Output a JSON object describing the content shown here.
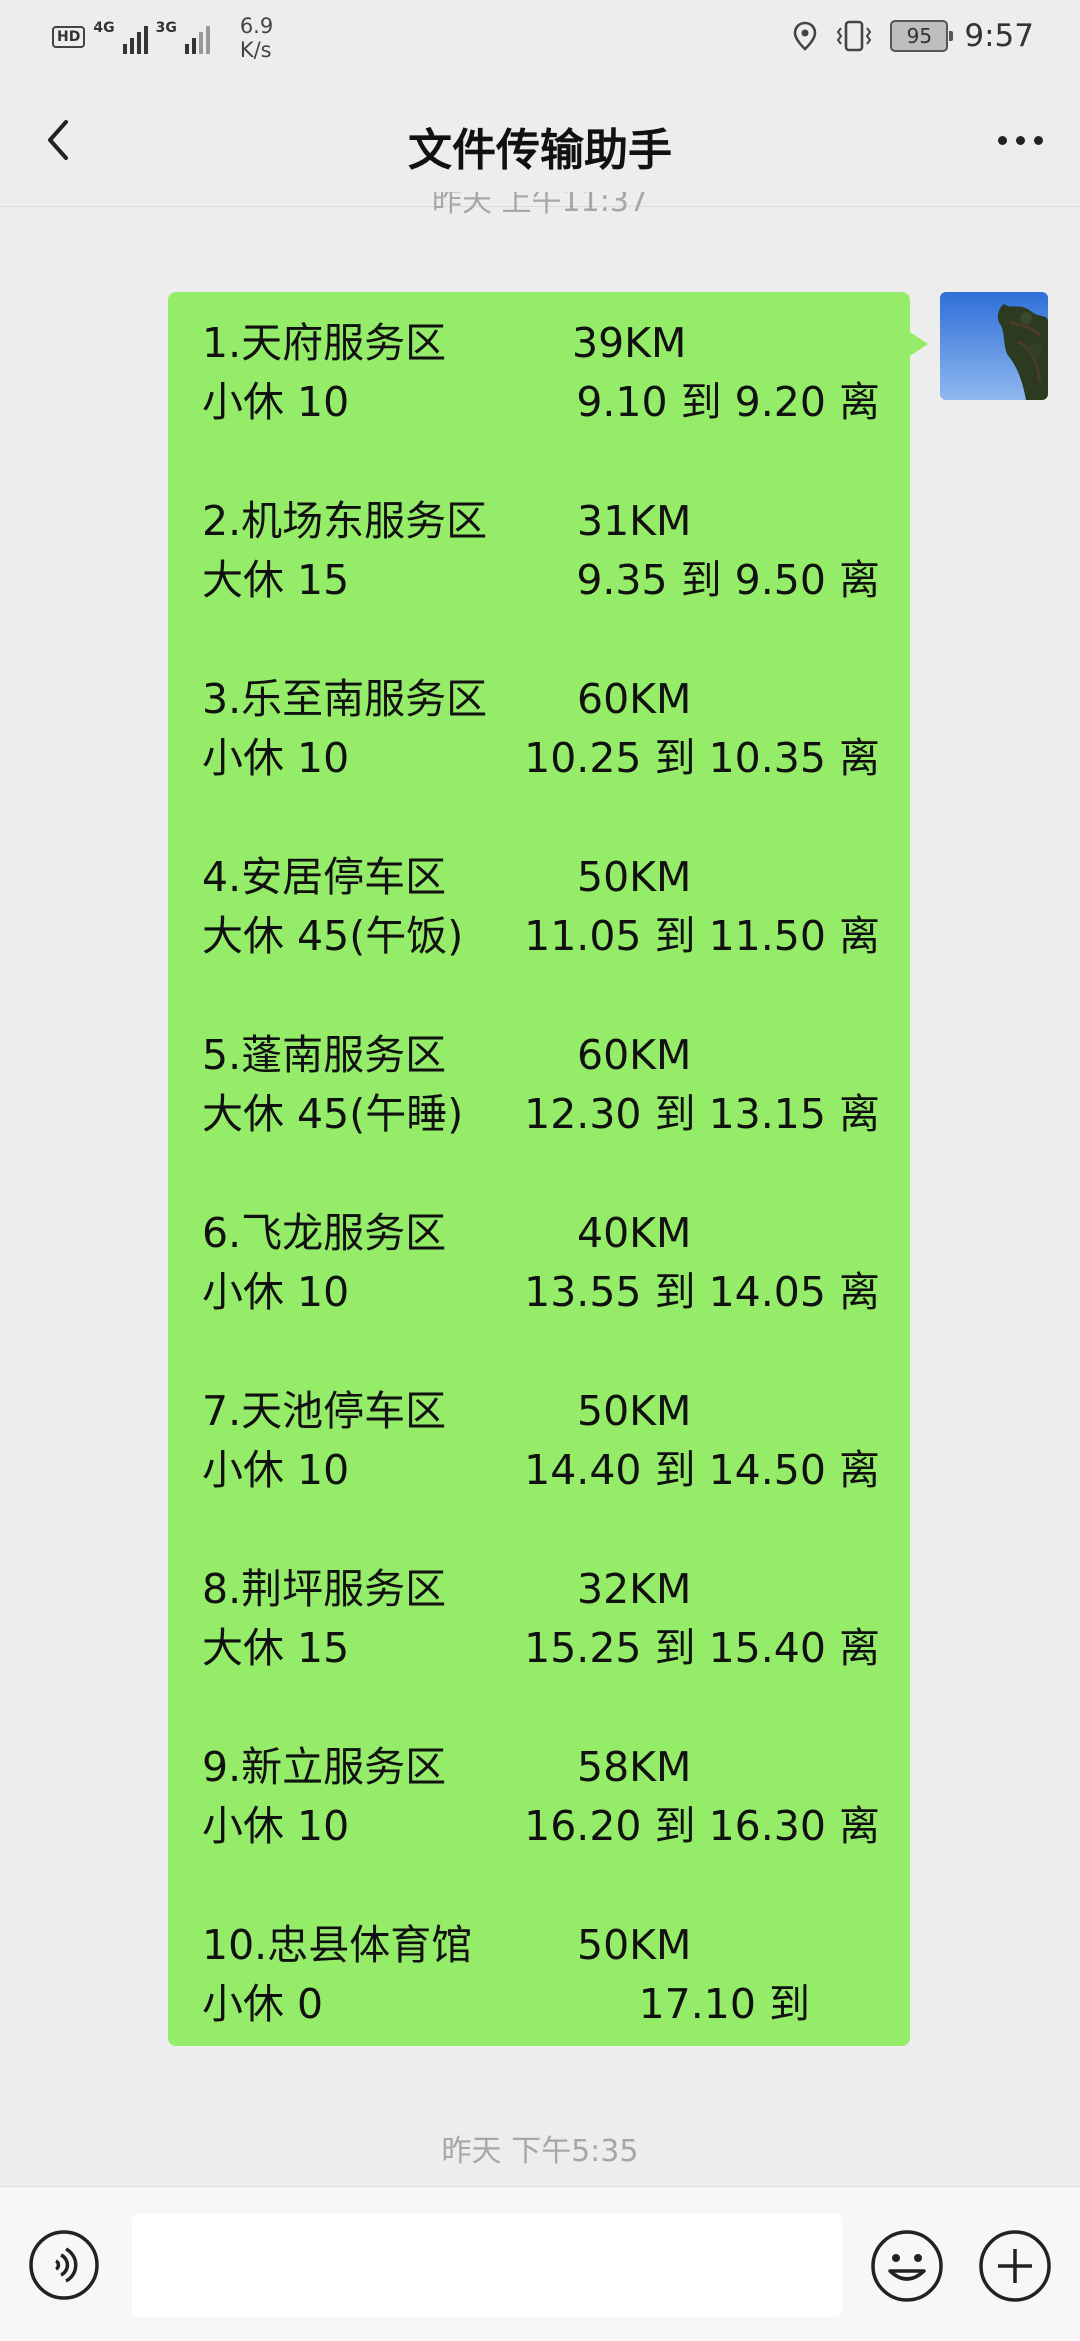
{
  "status_bar": {
    "hd": "HD",
    "net1": "4G",
    "net2": "3G",
    "speed_value": "6.9",
    "speed_unit": "K/s",
    "battery": "95",
    "time": "9:57"
  },
  "header": {
    "title": "文件传输助手"
  },
  "timestamp_top": "昨天 上午11:37",
  "message": {
    "rows": [
      [
        "1.天府服务区",
        "39KM"
      ],
      [
        "小休  10",
        "9.10 到 9.20 离"
      ],
      [
        "2.机场东服务区",
        "31KM"
      ],
      [
        "大休  15",
        "9.35 到 9.50 离"
      ],
      [
        "3.乐至南服务区",
        "60KM"
      ],
      [
        "小休  10",
        "10.25 到 10.35 离"
      ],
      [
        "4.安居停车区",
        "50KM"
      ],
      [
        "大休  45(午饭)",
        "11.05 到 11.50 离"
      ],
      [
        "5.蓬南服务区",
        "60KM"
      ],
      [
        "大休 45(午睡)",
        "12.30 到 13.15 离"
      ],
      [
        "6.飞龙服务区",
        "40KM"
      ],
      [
        "小休    10",
        "13.55 到 14.05 离"
      ],
      [
        "7.天池停车区",
        "50KM"
      ],
      [
        "小休   10",
        "14.40 到 14.50 离"
      ],
      [
        "8.荆坪服务区",
        "32KM"
      ],
      [
        "大休  15",
        "15.25 到 15.40 离"
      ],
      [
        "9.新立服务区",
        "58KM"
      ],
      [
        "小休   10",
        "16.20 到 16.30 离"
      ],
      [
        "10.忠县体育馆",
        "50KM"
      ],
      [
        "小休   0",
        "17.10 到"
      ]
    ]
  },
  "timestamp_bottom": "昨天 下午5:35",
  "input": {
    "value": ""
  },
  "icons": {
    "back": "back-arrow-icon",
    "more": "more-dots-icon",
    "voice": "voice-icon",
    "emoji": "emoji-icon",
    "plus": "plus-icon"
  },
  "colors": {
    "bubble": "#95ec69",
    "background": "#ededed"
  }
}
